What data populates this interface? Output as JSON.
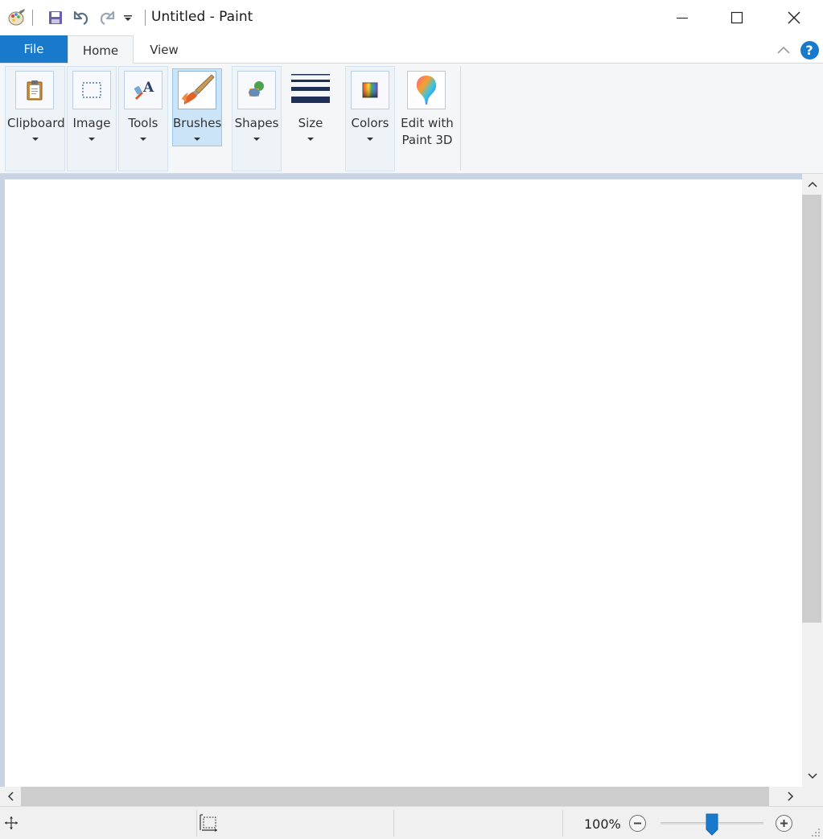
{
  "window": {
    "title": "Untitled - Paint",
    "buttons": [
      "minimize",
      "maximize",
      "close"
    ]
  },
  "quick_access": {
    "items": [
      "paint-app-icon",
      "save-icon",
      "undo-icon",
      "redo-icon",
      "customize-quick-access-icon"
    ]
  },
  "ribbon": {
    "tabs": [
      {
        "label": "File"
      },
      {
        "label": "Home",
        "active": true
      },
      {
        "label": "View"
      }
    ],
    "groups": {
      "clipboard": "Clipboard",
      "image": "Image",
      "tools": "Tools",
      "brushes": "Brushes",
      "shapes": "Shapes",
      "size": "Size",
      "colors": "Colors",
      "edit_3d_line1": "Edit with",
      "edit_3d_line2": "Paint 3D"
    },
    "help": "?"
  },
  "status": {
    "zoom_label": "100%",
    "zoom_percent": 100
  },
  "colors": {
    "accent": "#1979ca",
    "workspace_bg": "#c8d4e3",
    "selected_bg": "#cce4f7"
  }
}
